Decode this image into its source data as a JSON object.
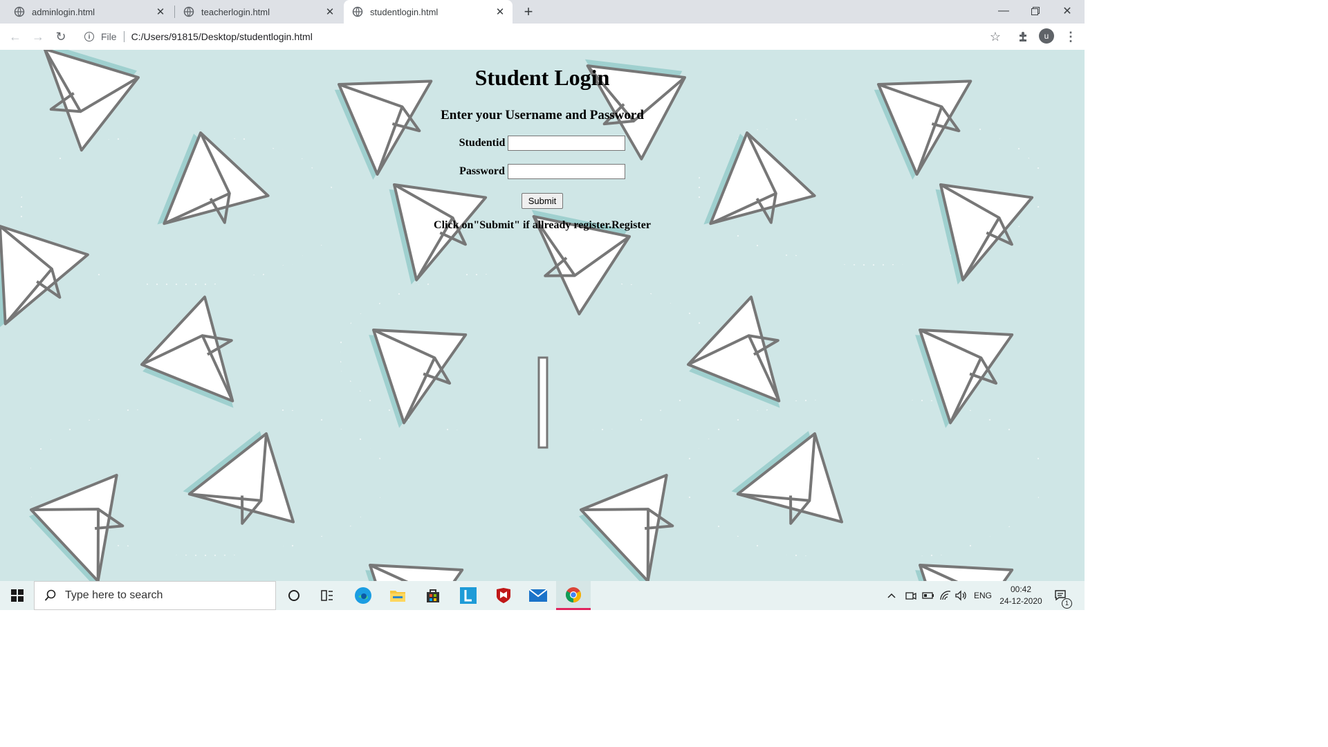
{
  "browser": {
    "tabs": [
      {
        "label": "adminlogin.html",
        "active": false
      },
      {
        "label": "teacherlogin.html",
        "active": false
      },
      {
        "label": "studentlogin.html",
        "active": true
      }
    ],
    "address": {
      "scheme_label": "File",
      "url": "C:/Users/91815/Desktop/studentlogin.html"
    },
    "profile_initial": "u"
  },
  "page": {
    "title": "Student Login",
    "subtitle": "Enter your Username and Password",
    "fields": {
      "studentid_label": "Studentid",
      "studentid_value": "",
      "password_label": "Password",
      "password_value": ""
    },
    "submit_label": "Submit",
    "hint": "Click on\"Submit\" if allready register.Register",
    "background_color": "#cfe6e6"
  },
  "taskbar": {
    "search_placeholder": "Type here to search",
    "language": "ENG",
    "time": "00:42",
    "date": "24-12-2020",
    "notification_count": "1"
  }
}
